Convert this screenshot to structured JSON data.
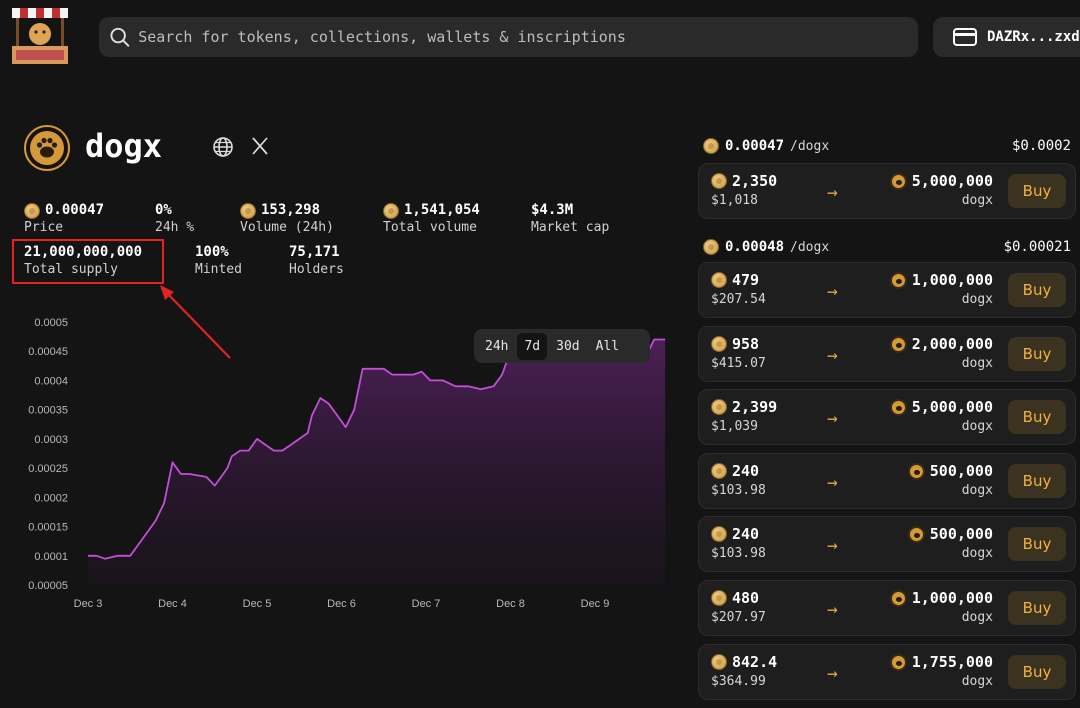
{
  "header": {
    "search_placeholder": "Search for tokens, collections, wallets & inscriptions",
    "wallet_label": "DAZRx...zxd"
  },
  "token": {
    "name": "dogx",
    "stats": [
      {
        "value": "0.00047",
        "label": "Price",
        "coin": true
      },
      {
        "value": "0%",
        "label": "24h %",
        "coin": false
      },
      {
        "value": "153,298",
        "label": "Volume (24h)",
        "coin": true
      },
      {
        "value": "1,541,054",
        "label": "Total volume",
        "coin": true
      },
      {
        "value": "$4.3M",
        "label": "Market cap",
        "coin": false
      },
      {
        "value": "21,000,000,000",
        "label": "Total supply",
        "coin": false
      },
      {
        "value": "100%",
        "label": "Minted",
        "coin": false
      },
      {
        "value": "75,171",
        "label": "Holders",
        "coin": false
      }
    ]
  },
  "timeframes": [
    "24h",
    "7d",
    "30d",
    "All"
  ],
  "active_timeframe": "7d",
  "colors": {
    "line": "#c24fd6",
    "buy_text": "#f2b33a",
    "highlight": "#e52222"
  },
  "chart_data": {
    "type": "area",
    "x_ticks": [
      "Dec 3",
      "Dec 4",
      "Dec 5",
      "Dec 6",
      "Dec 7",
      "Dec 8",
      "Dec 9"
    ],
    "y_ticks": [
      "0.00005",
      "0.0001",
      "0.00015",
      "0.0002",
      "0.00025",
      "0.0003",
      "0.00035",
      "0.0004",
      "0.00045",
      "0.0005"
    ],
    "ylim": [
      5e-05,
      0.0005
    ],
    "xlim": [
      3.0,
      9.83
    ],
    "x": [
      3.0,
      3.1,
      3.2,
      3.35,
      3.5,
      3.6,
      3.7,
      3.75,
      3.8,
      3.9,
      4.0,
      4.1,
      4.15,
      4.2,
      4.4,
      4.5,
      4.65,
      4.7,
      4.8,
      4.9,
      5.0,
      5.1,
      5.2,
      5.3,
      5.5,
      5.6,
      5.65,
      5.75,
      5.85,
      5.95,
      6.05,
      6.15,
      6.25,
      6.35,
      6.5,
      6.6,
      6.75,
      6.85,
      6.95,
      7.05,
      7.2,
      7.35,
      7.5,
      7.65,
      7.8,
      7.9,
      7.95,
      8.05,
      8.2,
      8.35,
      8.55,
      8.7,
      8.85,
      9.0,
      9.15,
      9.3,
      9.45,
      9.6,
      9.7,
      9.83
    ],
    "y": [
      0.0001,
      0.0001,
      9.5e-05,
      0.0001,
      0.0001,
      0.00012,
      0.00014,
      0.00015,
      0.00016,
      0.00019,
      0.00026,
      0.00024,
      0.00024,
      0.00024,
      0.000235,
      0.00022,
      0.00025,
      0.00027,
      0.00028,
      0.00028,
      0.0003,
      0.00029,
      0.00028,
      0.00028,
      0.0003,
      0.00031,
      0.00034,
      0.00037,
      0.00036,
      0.00034,
      0.00032,
      0.00035,
      0.00042,
      0.00042,
      0.00042,
      0.00041,
      0.00041,
      0.00041,
      0.000415,
      0.0004,
      0.0004,
      0.00039,
      0.00039,
      0.000385,
      0.00039,
      0.00041,
      0.00043,
      0.00046,
      0.00046,
      0.00046,
      0.000465,
      0.00048,
      0.000475,
      0.00046,
      0.00048,
      0.00046,
      0.00046,
      0.00044,
      0.00047,
      0.00047
    ]
  },
  "orders": [
    {
      "price": "0.00047",
      "unit": "/dogx",
      "usd_price": "$0.0002",
      "items": [
        {
          "pay": "2,350",
          "usd": "$1,018",
          "get": "5,000,000",
          "unit": "dogx",
          "buy": "Buy"
        }
      ]
    },
    {
      "price": "0.00048",
      "unit": "/dogx",
      "usd_price": "$0.00021",
      "items": [
        {
          "pay": "479",
          "usd": "$207.54",
          "get": "1,000,000",
          "unit": "dogx",
          "buy": "Buy"
        },
        {
          "pay": "958",
          "usd": "$415.07",
          "get": "2,000,000",
          "unit": "dogx",
          "buy": "Buy"
        },
        {
          "pay": "2,399",
          "usd": "$1,039",
          "get": "5,000,000",
          "unit": "dogx",
          "buy": "Buy"
        },
        {
          "pay": "240",
          "usd": "$103.98",
          "get": "500,000",
          "unit": "dogx",
          "buy": "Buy"
        },
        {
          "pay": "240",
          "usd": "$103.98",
          "get": "500,000",
          "unit": "dogx",
          "buy": "Buy"
        },
        {
          "pay": "480",
          "usd": "$207.97",
          "get": "1,000,000",
          "unit": "dogx",
          "buy": "Buy"
        },
        {
          "pay": "842.4",
          "usd": "$364.99",
          "get": "1,755,000",
          "unit": "dogx",
          "buy": "Buy"
        }
      ]
    }
  ]
}
